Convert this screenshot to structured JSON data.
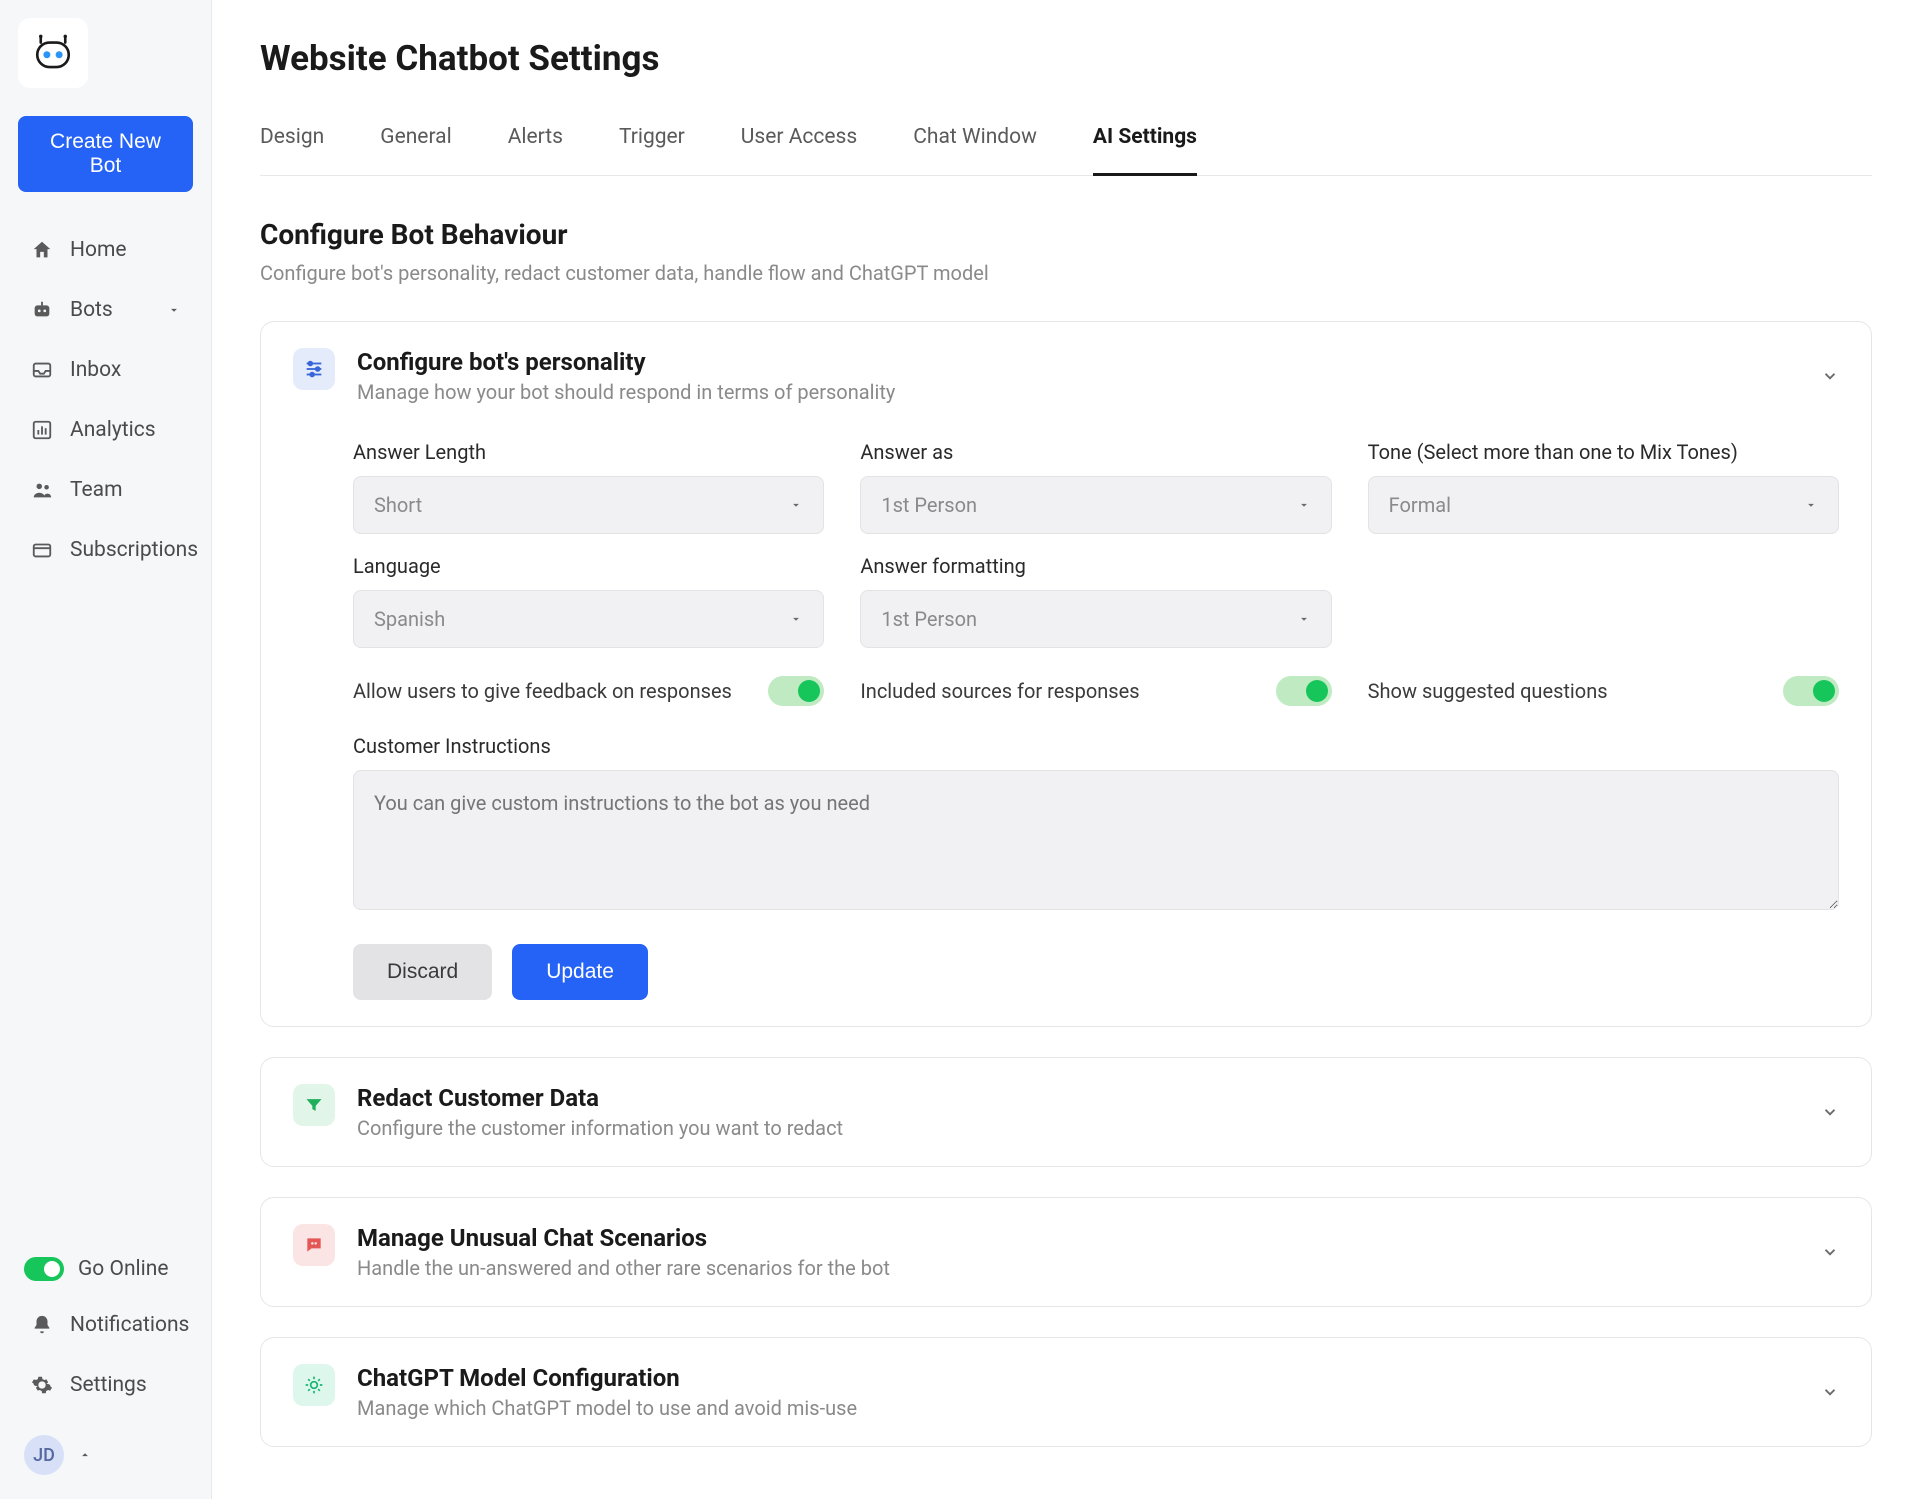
{
  "sidebar": {
    "create_btn": "Create New Bot",
    "items": [
      {
        "label": "Home"
      },
      {
        "label": "Bots"
      },
      {
        "label": "Inbox"
      },
      {
        "label": "Analytics"
      },
      {
        "label": "Team"
      },
      {
        "label": "Subscriptions"
      }
    ],
    "go_online": "Go Online",
    "notifications": "Notifications",
    "settings": "Settings",
    "avatar_initials": "JD"
  },
  "page": {
    "title": "Website Chatbot Settings",
    "tabs": [
      "Design",
      "General",
      "Alerts",
      "Trigger",
      "User Access",
      "Chat Window",
      "AI Settings"
    ],
    "active_tab": 6,
    "section_title": "Configure Bot Behaviour",
    "section_sub": "Configure bot's personality, redact customer data, handle flow and ChatGPT model"
  },
  "panels": {
    "personality": {
      "title": "Configure bot's personality",
      "sub": "Manage how your bot should respond in terms of personality",
      "fields": {
        "answer_length": {
          "label": "Answer Length",
          "value": "Short"
        },
        "answer_as": {
          "label": "Answer as",
          "value": "1st Person"
        },
        "tone": {
          "label": "Tone (Select more than one to Mix Tones)",
          "value": "Formal"
        },
        "language": {
          "label": "Language",
          "value": "Spanish"
        },
        "answer_formatting": {
          "label": "Answer formatting",
          "value": "1st Person"
        }
      },
      "toggles": {
        "feedback": "Allow users to give feedback on responses",
        "sources": "Included sources for responses",
        "suggested": "Show suggested questions"
      },
      "instructions_label": "Customer Instructions",
      "instructions_placeholder": "You can give custom instructions to the bot as you need",
      "discard": "Discard",
      "update": "Update"
    },
    "redact": {
      "title": "Redact Customer Data",
      "sub": "Configure the customer information you want to redact"
    },
    "unusual": {
      "title": "Manage Unusual Chat Scenarios",
      "sub": "Handle the un-answered and other rare scenarios for the bot"
    },
    "model": {
      "title": "ChatGPT Model Configuration",
      "sub": "Manage which ChatGPT model to use and avoid mis-use"
    }
  }
}
